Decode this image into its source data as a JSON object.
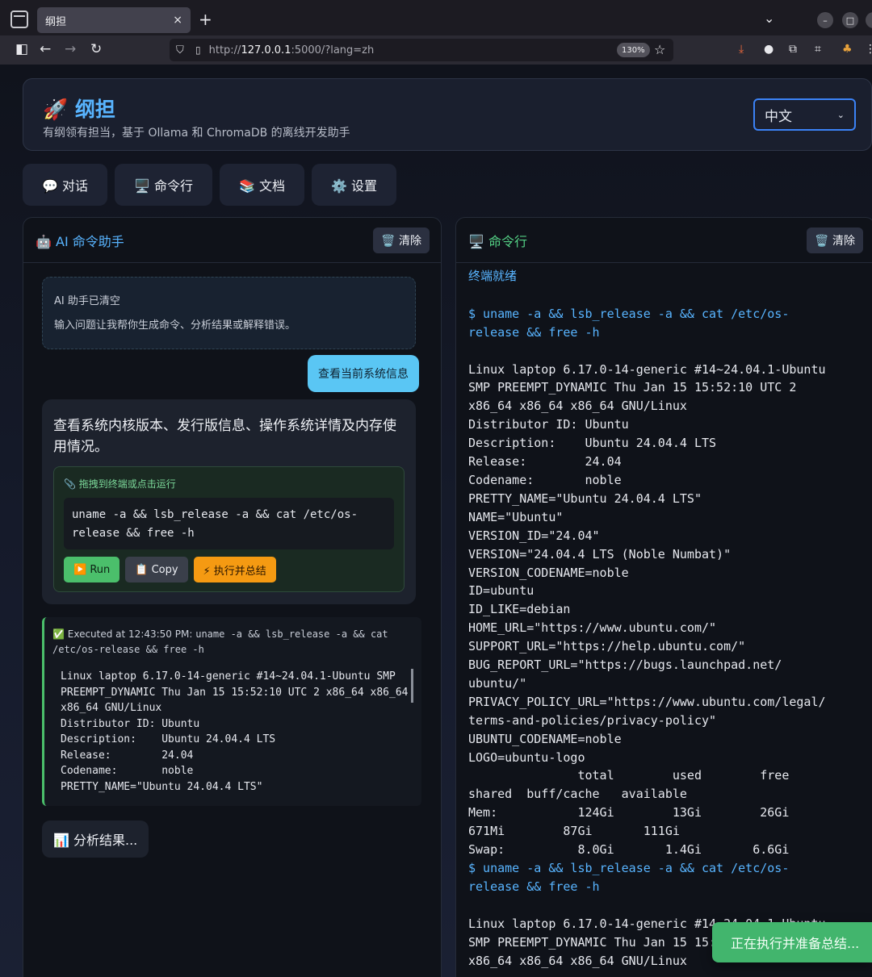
{
  "browser": {
    "tab_title": "纲担",
    "tab_close": "×",
    "new_tab": "+",
    "url_prefix": "http://",
    "url_host": "127.0.0.1",
    "url_rest": ":5000/?lang=zh",
    "zoom": "130%"
  },
  "app": {
    "title": "🚀 纲担",
    "subtitle": "有纲领有担当，基于 Ollama 和 ChromaDB 的离线开发助手",
    "language": "中文"
  },
  "nav_tabs": [
    {
      "label": "💬 对话"
    },
    {
      "label": "🖥️ 命令行"
    },
    {
      "label": "📚 文档"
    },
    {
      "label": "⚙️ 设置"
    }
  ],
  "left_panel": {
    "title": "🤖 AI 命令助手",
    "clear_label": "🗑️ 清除",
    "system_message": {
      "line1": "AI 助手已清空",
      "line2": "输入问题让我帮你生成命令、分析结果或解释错误。"
    },
    "user_message": "查看当前系统信息",
    "ai_reply": "查看系统内核版本、发行版信息、操作系统详情及内存使用情况。",
    "command_hint": "📎 拖拽到终端或点击运行",
    "command": "uname -a && lsb_release -a && cat /etc/os-release && free -h",
    "run_label": "▶️ Run",
    "copy_label": "📋 Copy",
    "exec_label": "⚡ 执行并总结",
    "exec_head": "✅ Executed at 12:43:50 PM: ",
    "exec_cmd": "uname -a && lsb_release -a && cat /etc/os-release && free -h",
    "exec_output": "Linux laptop 6.17.0-14-generic #14~24.04.1-Ubuntu SMP\nPREEMPT_DYNAMIC Thu Jan 15 15:52:10 UTC 2 x86_64 x86_64\nx86_64 GNU/Linux\nDistributor ID: Ubuntu\nDescription:    Ubuntu 24.04.4 LTS\nRelease:        24.04\nCodename:       noble\nPRETTY_NAME=\"Ubuntu 24.04.4 LTS\"",
    "analysis_label": "📊 分析结果..."
  },
  "right_panel": {
    "title": "🖥️ 命令行",
    "clear_label": "🗑️ 清除",
    "ready": "终端就绪",
    "cmd1": "$ uname -a && lsb_release -a && cat /etc/os-\nrelease && free -h",
    "output1": "Linux laptop 6.17.0-14-generic #14~24.04.1-Ubuntu\nSMP PREEMPT_DYNAMIC Thu Jan 15 15:52:10 UTC 2\nx86_64 x86_64 x86_64 GNU/Linux\nDistributor ID: Ubuntu\nDescription:    Ubuntu 24.04.4 LTS\nRelease:        24.04\nCodename:       noble\nPRETTY_NAME=\"Ubuntu 24.04.4 LTS\"\nNAME=\"Ubuntu\"\nVERSION_ID=\"24.04\"\nVERSION=\"24.04.4 LTS (Noble Numbat)\"\nVERSION_CODENAME=noble\nID=ubuntu\nID_LIKE=debian\nHOME_URL=\"https://www.ubuntu.com/\"\nSUPPORT_URL=\"https://help.ubuntu.com/\"\nBUG_REPORT_URL=\"https://bugs.launchpad.net/\nubuntu/\"\nPRIVACY_POLICY_URL=\"https://www.ubuntu.com/legal/\nterms-and-policies/privacy-policy\"\nUBUNTU_CODENAME=noble\nLOGO=ubuntu-logo\n               total        used        free\nshared  buff/cache   available\nMem:           124Gi        13Gi        26Gi\n671Mi        87Gi       111Gi\nSwap:          8.0Gi       1.4Gi       6.6Gi",
    "cmd2": "$ uname -a && lsb_release -a && cat /etc/os-\nrelease && free -h",
    "output2": "Linux laptop 6.17.0-14-generic #14~24.04.1-Ubuntu\nSMP PREEMPT_DYNAMIC Thu Jan 15 15:52:10 UTC 2\nx86_64 x86_64 x86_64 GNU/Linux"
  },
  "toast": "正在执行并准备总结..."
}
